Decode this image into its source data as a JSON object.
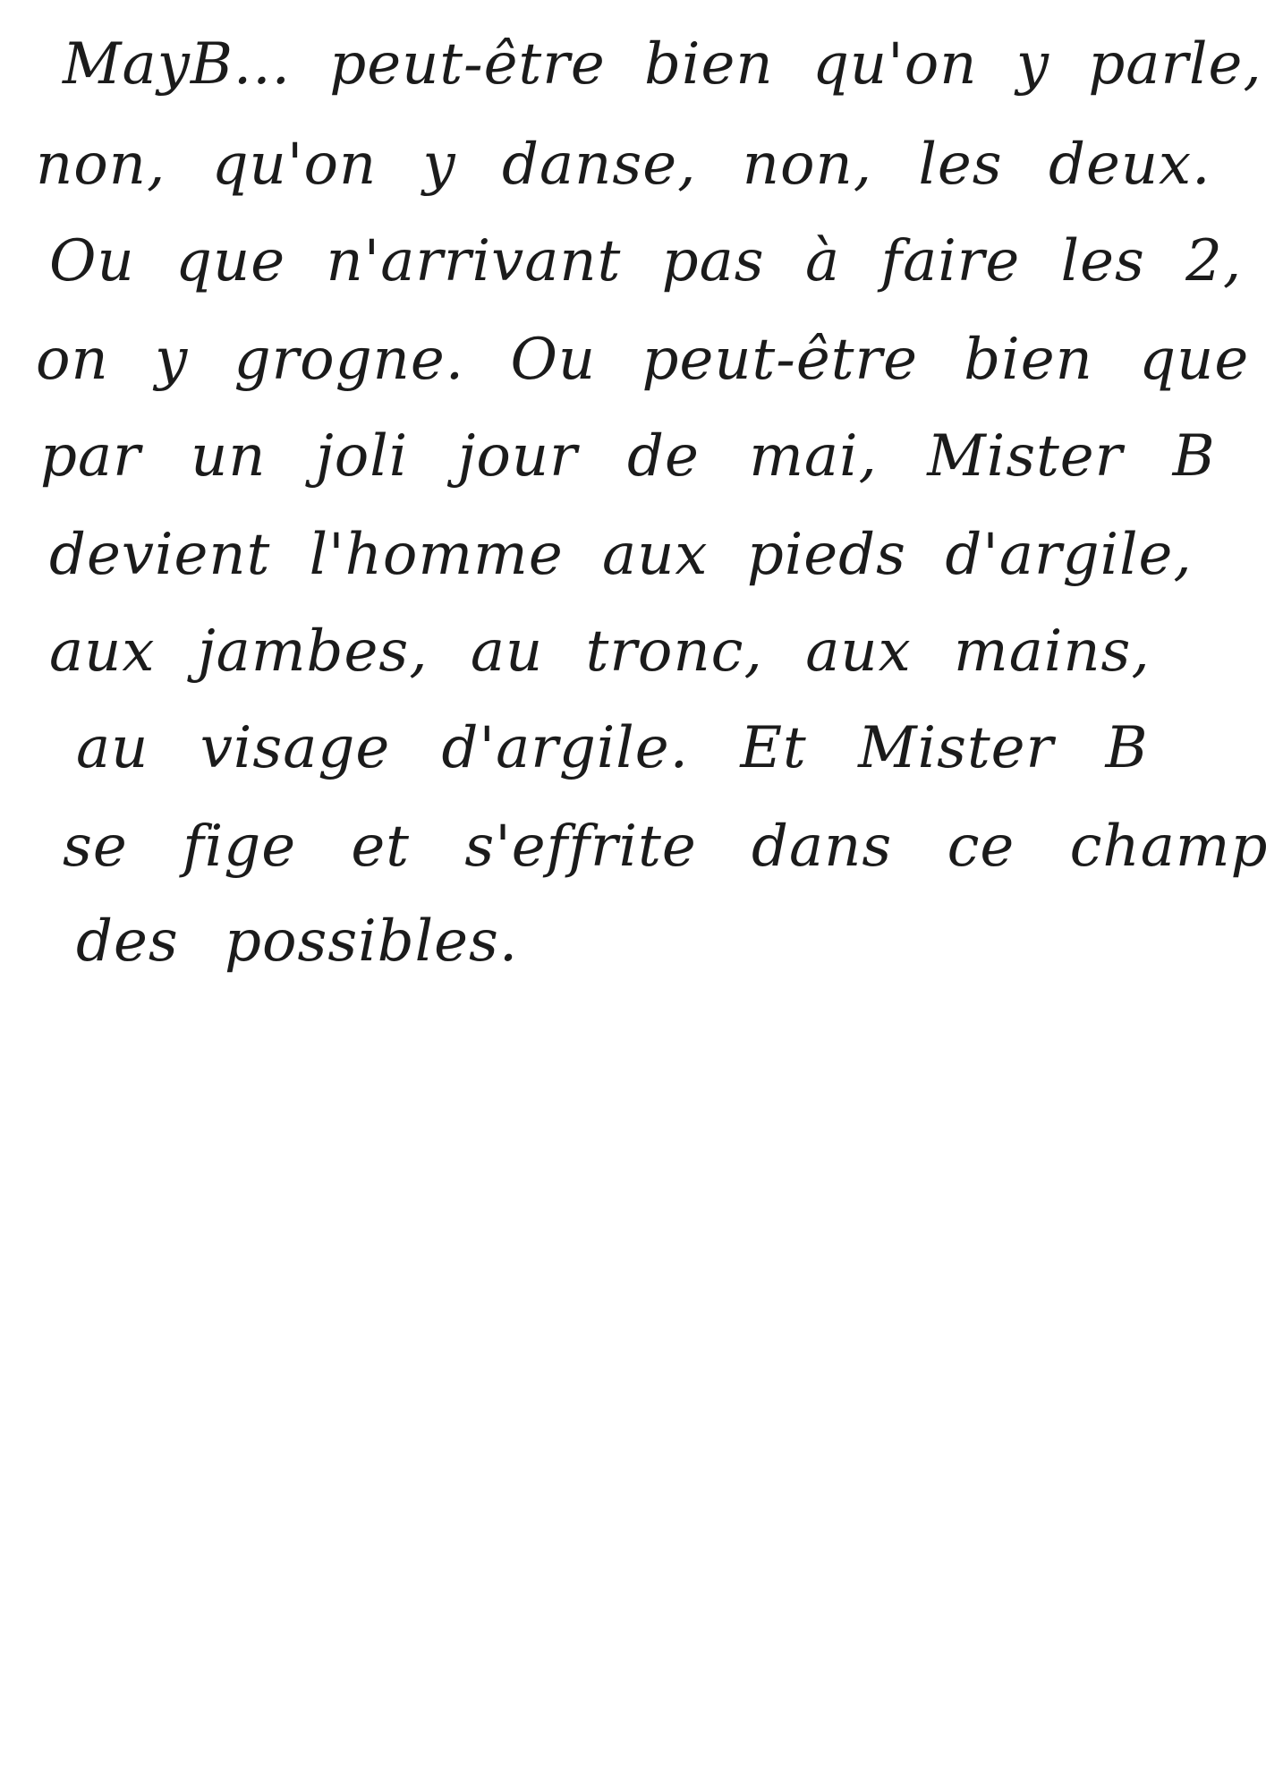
{
  "lines": [
    "MayB... peut-être bien qu'on y parle,",
    "non, qu'on y danse, non, les deux.",
    "Ou que n'arrivant pas à faire les 2,",
    "on y grogne. Ou peut-être bien que",
    "par un joli jour de mai, Mister B",
    "devient l'homme aux pieds d'argile,",
    "aux jambes, au tronc, aux mains,",
    "au visage d'argile. Et Mister B",
    "se fige et s'effrite dans ce champ",
    "des possibles."
  ]
}
